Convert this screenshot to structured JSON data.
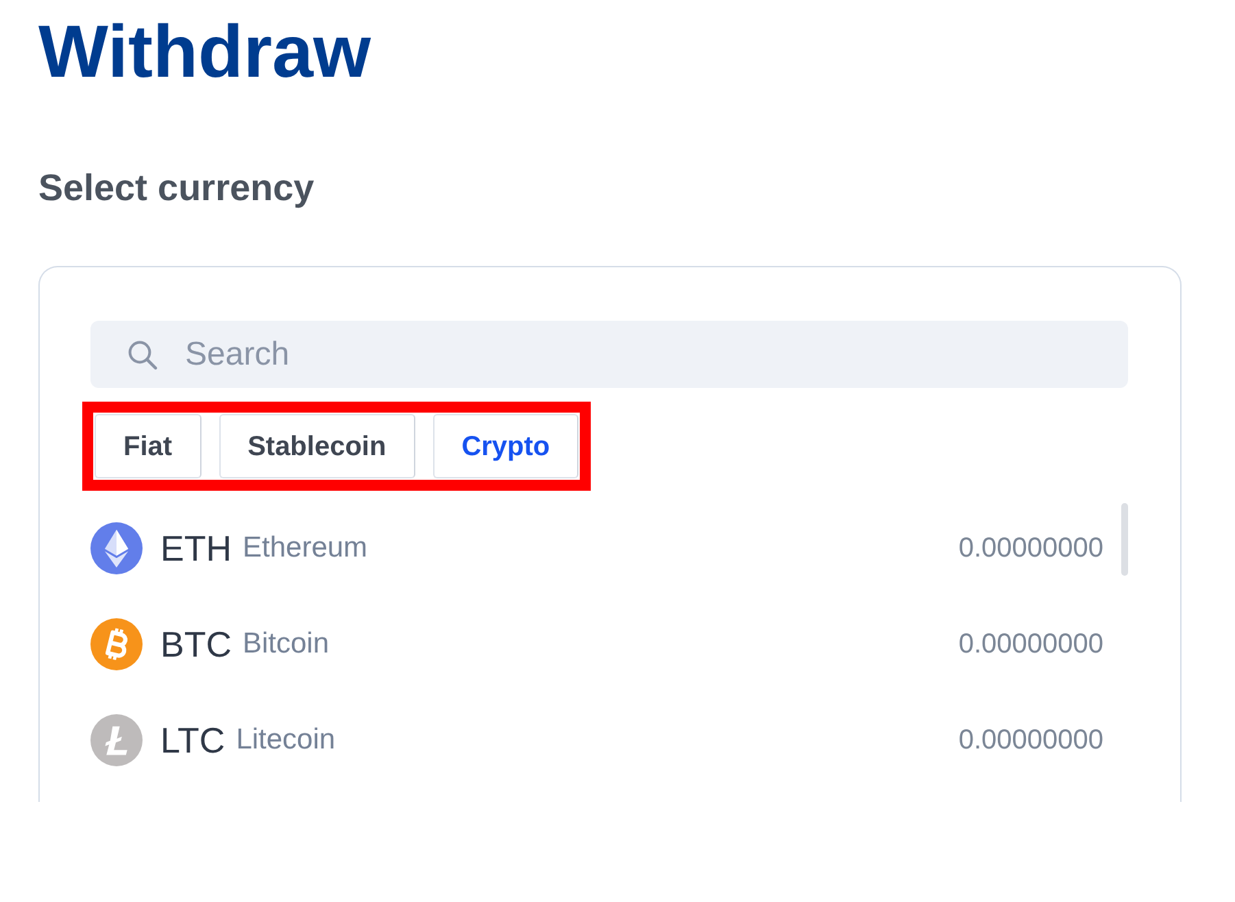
{
  "page": {
    "title": "Withdraw",
    "subtitle": "Select currency"
  },
  "search": {
    "placeholder": "Search"
  },
  "filter_tabs": {
    "highlighted": true,
    "items": [
      {
        "label": "Fiat",
        "selected": false
      },
      {
        "label": "Stablecoin",
        "selected": false
      },
      {
        "label": "Crypto",
        "selected": true
      }
    ]
  },
  "currencies": [
    {
      "kind": "ethereum",
      "color": "#627eea",
      "code": "ETH",
      "name": "Ethereum",
      "balance": "0.00000000"
    },
    {
      "kind": "bitcoin",
      "color": "#f7931a",
      "code": "BTC",
      "name": "Bitcoin",
      "balance": "0.00000000"
    },
    {
      "kind": "litecoin",
      "color": "#bebbbb",
      "code": "LTC",
      "name": "Litecoin",
      "balance": "0.00000000"
    }
  ]
}
